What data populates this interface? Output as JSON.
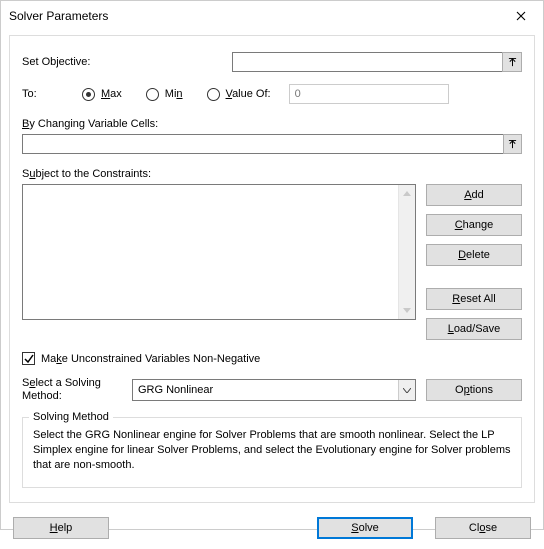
{
  "title": "Solver Parameters",
  "labels": {
    "set_objective": "Set Objective:",
    "to": "To:",
    "max": "Max",
    "min": "Min",
    "value_of": "Value Of:",
    "changing_cells": "By Changing Variable Cells:",
    "constraints": "Subject to the Constraints:",
    "nonneg": "Make Unconstrained Variables Non-Negative",
    "method_label": "Select a Solving Method:",
    "method_selected": "GRG Nonlinear",
    "desc_legend": "Solving Method",
    "desc_text": "Select the GRG Nonlinear engine for Solver Problems that are smooth nonlinear. Select the LP Simplex engine for linear Solver Problems, and select the Evolutionary engine for Solver problems that are non-smooth."
  },
  "inputs": {
    "objective": "",
    "value_of": "0",
    "changing_cells": ""
  },
  "radio_selected": "max",
  "nonneg_checked": true,
  "buttons": {
    "add": "Add",
    "change": "Change",
    "delete": "Delete",
    "reset": "Reset All",
    "loadsave": "Load/Save",
    "options": "Options",
    "help": "Help",
    "solve": "Solve",
    "close": "Close"
  }
}
